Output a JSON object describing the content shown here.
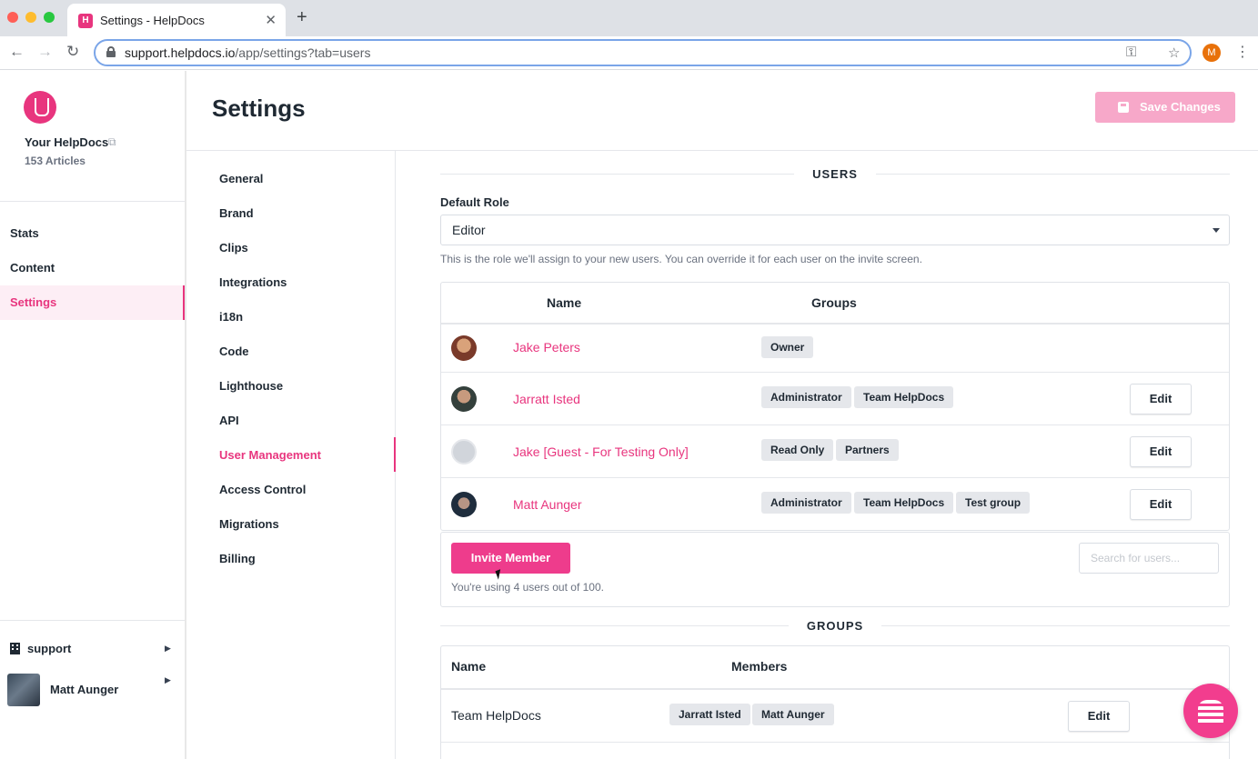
{
  "browser": {
    "tab_title": "Settings - HelpDocs",
    "url_host": "support.helpdocs.io",
    "url_path": "/app/settings?tab=users",
    "profile_initial": "M"
  },
  "sidebar": {
    "org_name": "Your HelpDocs",
    "article_count": "153 Articles",
    "items": [
      {
        "label": "Stats"
      },
      {
        "label": "Content"
      },
      {
        "label": "Settings",
        "active": true
      }
    ],
    "account": "support",
    "user_name": "Matt Aunger"
  },
  "header": {
    "title": "Settings",
    "save_label": "Save Changes"
  },
  "submenu": {
    "items": [
      {
        "label": "General"
      },
      {
        "label": "Brand"
      },
      {
        "label": "Clips"
      },
      {
        "label": "Integrations"
      },
      {
        "label": "i18n"
      },
      {
        "label": "Code"
      },
      {
        "label": "Lighthouse"
      },
      {
        "label": "API"
      },
      {
        "label": "User Management",
        "active": true
      },
      {
        "label": "Access Control"
      },
      {
        "label": "Migrations"
      },
      {
        "label": "Billing"
      }
    ]
  },
  "users": {
    "section_title": "USERS",
    "default_role_label": "Default Role",
    "default_role_value": "Editor",
    "hint": "This is the role we'll assign to your new users. You can override it for each user on the invite screen.",
    "columns": [
      "Name",
      "Groups"
    ],
    "rows": [
      {
        "name": "Jake Peters",
        "groups": [
          "Owner"
        ],
        "edit": ""
      },
      {
        "name": "Jarratt Isted",
        "groups": [
          "Administrator",
          "Team HelpDocs"
        ],
        "edit": "Edit"
      },
      {
        "name": "Jake [Guest - For Testing Only]",
        "groups": [
          "Read Only",
          "Partners"
        ],
        "edit": "Edit"
      },
      {
        "name": "Matt Aunger",
        "groups": [
          "Administrator",
          "Team HelpDocs",
          "Test group"
        ],
        "edit": "Edit"
      }
    ],
    "invite_label": "Invite Member",
    "search_placeholder": "Search for users...",
    "usage": "You're using 4 users out of 100."
  },
  "groups": {
    "section_title": "GROUPS",
    "columns": [
      "Name",
      "Members"
    ],
    "rows": [
      {
        "name": "Team HelpDocs",
        "members": [
          "Jarratt Isted",
          "Matt Aunger"
        ],
        "edit": "Edit"
      }
    ]
  },
  "colors": {
    "brand": "#e8357e",
    "save_disabled": "#f7a8c9"
  }
}
